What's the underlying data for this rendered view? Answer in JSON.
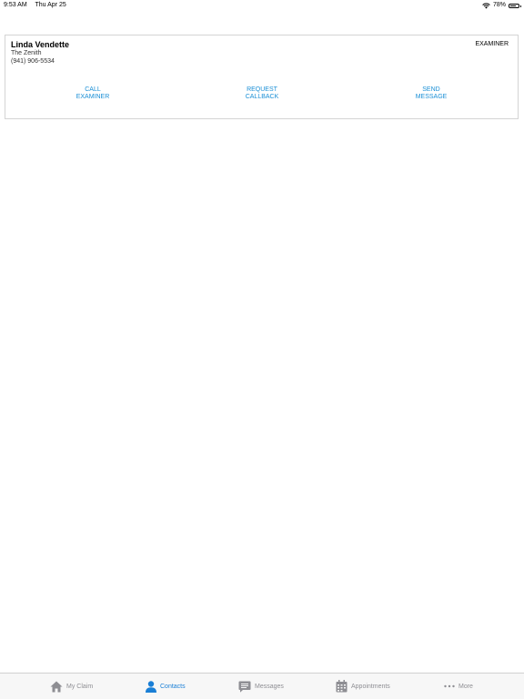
{
  "status": {
    "time": "9:53 AM",
    "date": "Thu Apr 25",
    "battery": "78%",
    "battery_level": 0.78,
    "wifi_icon": "wifi-icon",
    "battery_icon": "battery-icon"
  },
  "contact": {
    "name": "Linda Vendette",
    "company": "The Zenith",
    "phone": "(941) 906-5534",
    "role": "EXAMINER",
    "actions": [
      {
        "line1": "CALL",
        "line2": "EXAMINER"
      },
      {
        "line1": "REQUEST",
        "line2": "CALLBACK"
      },
      {
        "line1": "SEND",
        "line2": "MESSAGE"
      }
    ]
  },
  "tabs": [
    {
      "label": "My Claim",
      "icon": "home-icon",
      "active": false
    },
    {
      "label": "Contacts",
      "icon": "person-icon",
      "active": true
    },
    {
      "label": "Messages",
      "icon": "message-icon",
      "active": false
    },
    {
      "label": "Appointments",
      "icon": "calendar-icon",
      "active": false
    },
    {
      "label": "More",
      "icon": "ellipsis-icon",
      "active": false
    }
  ],
  "colors": {
    "accent": "#1a8fd6",
    "tab_active": "#1a7fd6",
    "tab_inactive": "#8e8e93"
  }
}
